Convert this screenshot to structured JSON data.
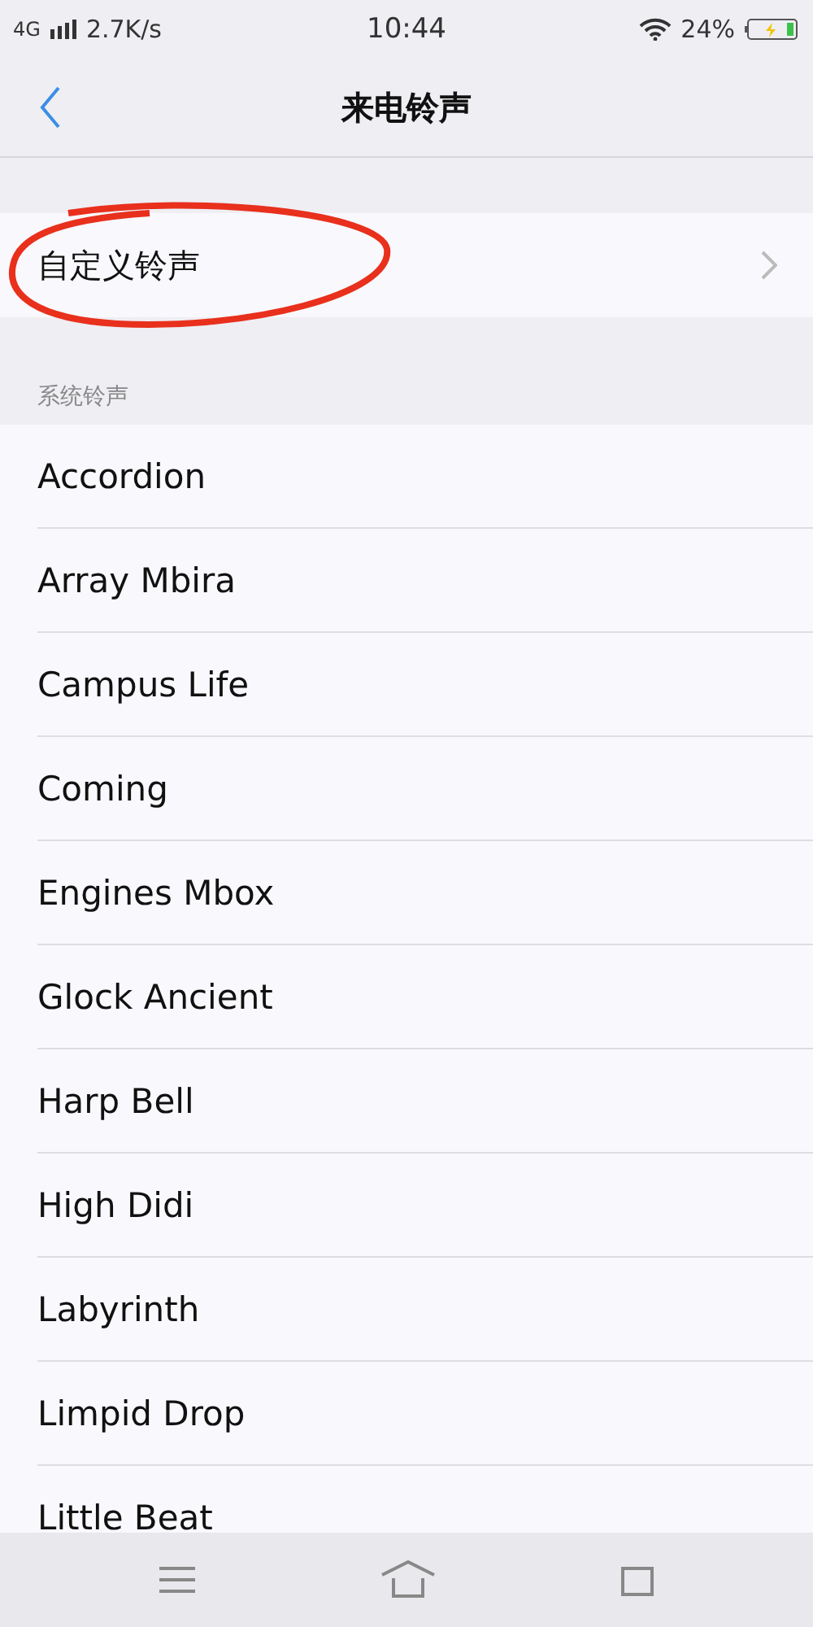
{
  "status_bar": {
    "network": "4G",
    "speed": "2.7K/s",
    "time": "10:44",
    "battery": "24%"
  },
  "header": {
    "title": "来电铃声"
  },
  "custom_ringtone": {
    "label": "自定义铃声",
    "annotated": true
  },
  "section": {
    "title": "系统铃声"
  },
  "ringtones": [
    {
      "name": "Accordion"
    },
    {
      "name": "Array Mbira"
    },
    {
      "name": "Campus Life"
    },
    {
      "name": "Coming"
    },
    {
      "name": "Engines Mbox"
    },
    {
      "name": "Glock Ancient"
    },
    {
      "name": "Harp Bell"
    },
    {
      "name": "High Didi"
    },
    {
      "name": "Labyrinth"
    },
    {
      "name": "Limpid Drop"
    },
    {
      "name": "Little Beat"
    }
  ]
}
